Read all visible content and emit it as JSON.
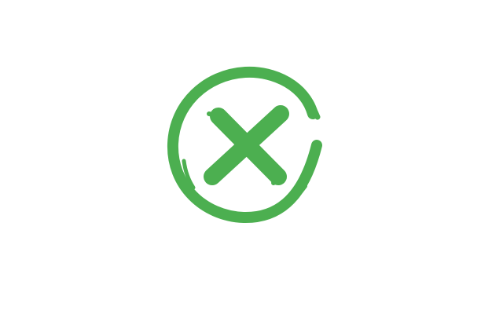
{
  "icon": {
    "name": "close-circle-icon",
    "color": "#4CAF50",
    "background": "#ffffff"
  }
}
